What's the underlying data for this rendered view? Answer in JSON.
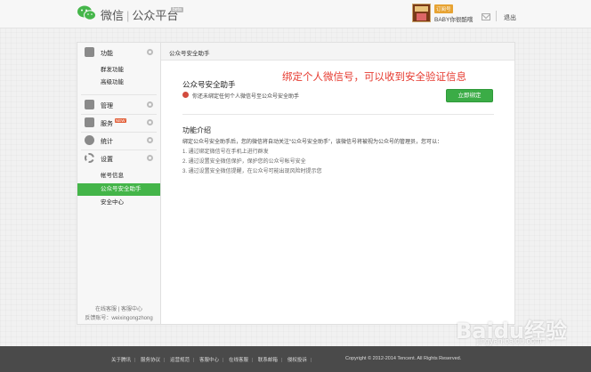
{
  "header": {
    "brand_left": "微信",
    "brand_sep": "|",
    "brand_right": "公众平台",
    "beta": "beta",
    "account_tag": "订阅号",
    "account_name": "BABY你很酷哦",
    "logout": "退出"
  },
  "sidebar": {
    "sections": [
      {
        "label": "功能",
        "icon": "grid-icon"
      },
      {
        "label": "管理",
        "icon": "inbox-icon"
      },
      {
        "label": "服务",
        "icon": "briefcase-icon",
        "badge": "NEW"
      },
      {
        "label": "统计",
        "icon": "pie-chart-icon"
      },
      {
        "label": "设置",
        "icon": "gear-icon"
      }
    ],
    "feature_items": [
      "群发功能",
      "高级功能"
    ],
    "settings_items": [
      "帐号信息",
      "公众号安全助手",
      "安全中心"
    ],
    "footer_line1": "在线客服 | 客服中心",
    "footer_line2": "反馈账号：weixingongzhong"
  },
  "main": {
    "breadcrumb": "公众号安全助手",
    "annotation": "绑定个人微信号，可以收到安全验证信息",
    "section_title": "公众号安全助手",
    "warning": "你还未绑定任何个人微信号至公众号安全助手",
    "bind_button": "立即绑定",
    "intro_title": "功能介绍",
    "intro_desc": "绑定公众号安全助手后，您的微信将自动关注“公众号安全助手”，该微信号将被视为公众号的管理员，您可以：",
    "steps": [
      "1. 通过绑定微信号在手机上进行群发",
      "2. 通过设置安全微信保护，保护您的公众号帐号安全",
      "3. 通过设置安全微信提醒，在公众号可能出现风险时提示您"
    ]
  },
  "footer": {
    "links": [
      "关于腾讯",
      "服务协议",
      "运营规范",
      "客服中心",
      "在线客服",
      "联系邮箱",
      "侵权投诉"
    ],
    "copyright": "Copyright © 2012-2014 Tencent. All Rights Reserved."
  },
  "watermark": {
    "text": "Baidu经验",
    "url": "jingyan.baidu.com"
  },
  "colors": {
    "accent_green": "#44b549",
    "annotation_red": "#e63b30",
    "footer_bg": "#4a4a4a"
  }
}
